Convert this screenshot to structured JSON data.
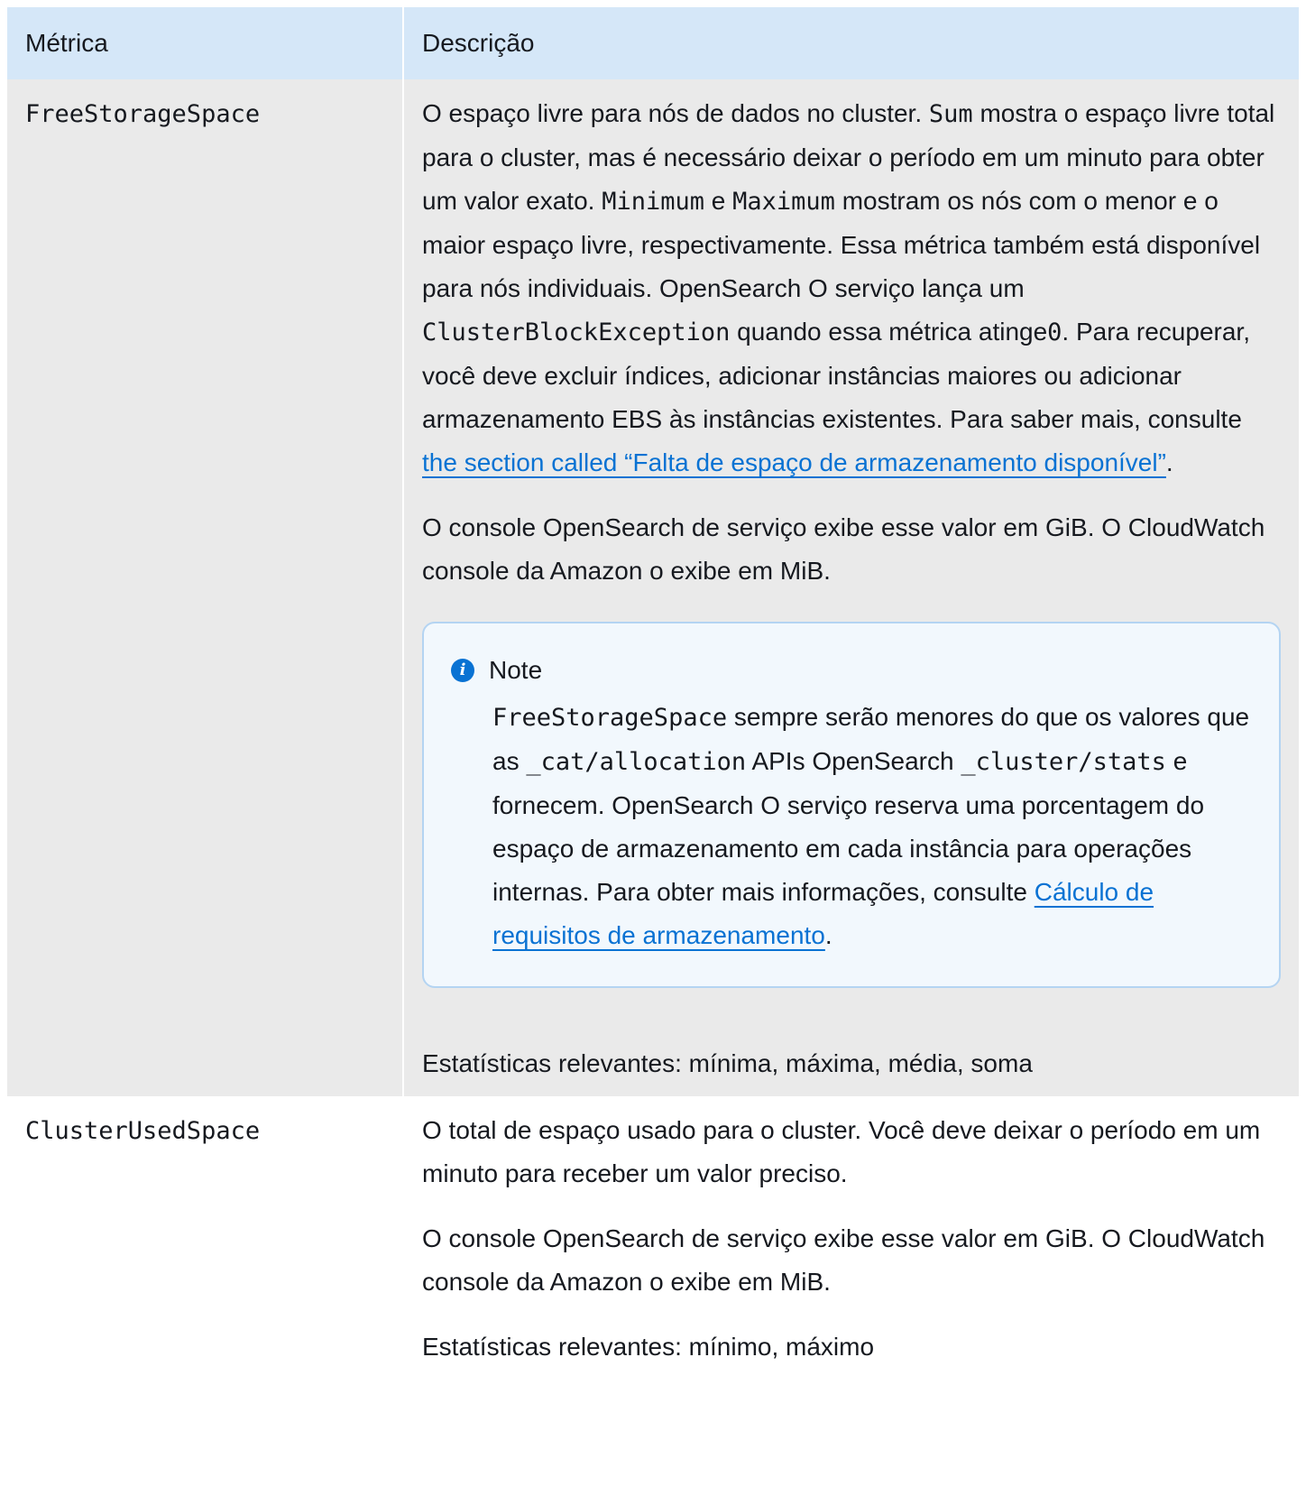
{
  "table": {
    "headers": [
      "Métrica",
      "Descrição"
    ],
    "rows": [
      {
        "metric": "FreeStorageSpace",
        "p1": {
          "t1": "O espaço livre para nós de dados no cluster.",
          "c1": "Sum",
          "t2": "mostra o espaço livre total para o cluster, mas é necessário deixar o período em um minuto para obter um valor exato.",
          "c2": "Minimum",
          "t3": "e",
          "c3": "Maximum",
          "t4": "mostram os nós com o menor e o maior espaço livre, respectivamente. Essa métrica também está disponível para nós individuais. OpenSearch O serviço lança um",
          "c4": "ClusterBlockException",
          "t5": "quando essa métrica atinge",
          "c5": "0",
          "t6": ". Para recuperar, você deve excluir índices, adicionar instâncias maiores ou adicionar armazenamento EBS às instâncias existentes. Para saber mais, consulte",
          "link": "the section called “Falta de espaço de armazenamento disponível”",
          "end": "."
        },
        "p2": "O console OpenSearch de serviço exibe esse valor em GiB. O CloudWatch console da Amazon o exibe em MiB.",
        "note": {
          "title": "Note",
          "c1": "FreeStorageSpace",
          "t1": "sempre serão menores do que os valores que as",
          "c2": "_cat/allocation",
          "t2": "APIs OpenSearch",
          "c3": "_cluster/stats",
          "t3": "e fornecem. OpenSearch O serviço reserva uma porcentagem do espaço de armazenamento em cada instância para operações internas. Para obter mais informações, consulte",
          "link": "Cálculo de requisitos de armazenamento",
          "end": "."
        },
        "stats": "Estatísticas relevantes: mínima, máxima, média, soma"
      },
      {
        "metric": "ClusterUsedSpace",
        "p1": "O total de espaço usado para o cluster. Você deve deixar o período em um minuto para receber um valor preciso.",
        "p2": "O console OpenSearch de serviço exibe esse valor em GiB. O CloudWatch console da Amazon o exibe em MiB.",
        "stats": "Estatísticas relevantes: mínimo, máximo"
      }
    ]
  },
  "colors": {
    "header_bg": "#d5e7f8",
    "row_alt_bg": "#eaeaea",
    "link": "#0972d3",
    "note_bg": "#f2f8fd",
    "note_border": "#b4d4f2"
  },
  "icons": {
    "note_icon": "info-circle-icon"
  }
}
